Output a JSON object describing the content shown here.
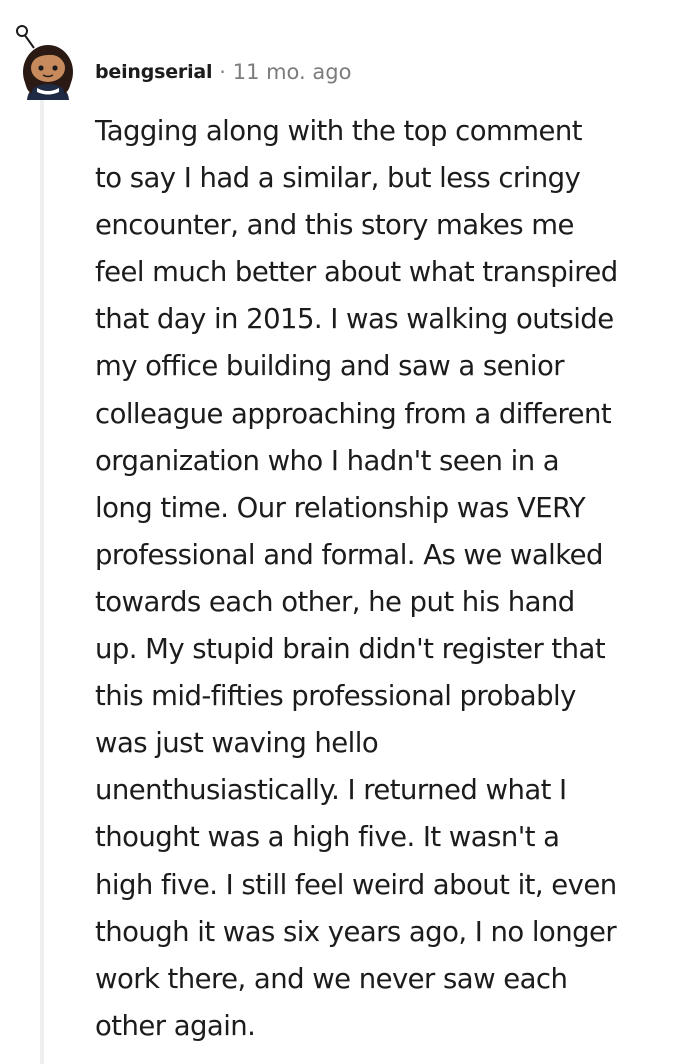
{
  "comment": {
    "username": "beingserial",
    "separator": "·",
    "timestamp": "11 mo. ago",
    "avatar_icon": "snoo-avatar-icon",
    "body_lines": [
      "Tagging along with the top comment",
      "to say I had a similar, but less cringy",
      "encounter, and this story makes me",
      "feel much better about what transpired",
      "that day in 2015. I was walking outside",
      "my office building and saw a senior",
      "colleague approaching from a different",
      "organization who I hadn't seen in a",
      "long time. Our relationship was VERY",
      "professional and formal. As we walked",
      "towards each other, he put his hand",
      "up. My stupid brain didn't register that",
      "this mid-fifties professional probably",
      "was just waving hello",
      "unenthusiastically. I returned what I",
      "thought was a high five. It wasn't a",
      "high five. I still feel weird about it, even",
      "though it was six years ago, I no longer",
      "work there, and we never saw each",
      "other again."
    ]
  },
  "colors": {
    "text": "#1c1c1c",
    "meta": "#7c7c7c",
    "thread_line": "#edeff1"
  }
}
